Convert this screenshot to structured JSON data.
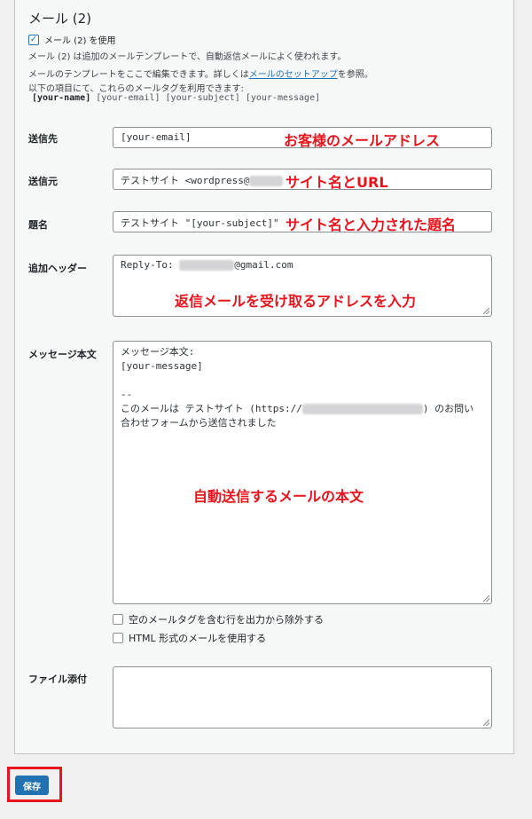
{
  "section": {
    "title": "メール (2)",
    "use_checkbox_label": "メール (2) を使用",
    "description": "メール (2) は追加のメールテンプレートで、自動返信メールによく使われます。",
    "edit_text_before": "メールのテンプレートをここで編集できます。詳しくは",
    "edit_link": "メールのセットアップ",
    "edit_text_after": "を参照。",
    "tags_intro": "以下の項目にて、これらのメールタグを利用できます:",
    "tags": {
      "name": "[your-name]",
      "others": " [your-email] [your-subject] [your-message]"
    }
  },
  "fields": {
    "to": {
      "label": "送信先",
      "value": "[your-email]",
      "annotation": "お客様のメールアドレス"
    },
    "from": {
      "label": "送信元",
      "value": "テストサイト <wordpress@",
      "annotation": "サイト名とURL"
    },
    "subject": {
      "label": "題名",
      "value": "テストサイト \"[your-subject]\"",
      "annotation": "サイト名と入力された題名"
    },
    "headers": {
      "label": "追加ヘッダー",
      "value_prefix": "Reply-To: ",
      "value_suffix": "@gmail.com",
      "annotation": "返信メールを受け取るアドレスを入力"
    },
    "body": {
      "label": "メッセージ本文",
      "line1": "メッセージ本文:",
      "line2": "[your-message]",
      "line3": "--",
      "line4_prefix": "このメールは テストサイト (https://",
      "line4_suffix": ") のお問い",
      "line5": "合わせフォームから送信されました",
      "annotation": "自動送信するメールの本文"
    },
    "attachments": {
      "label": "ファイル添付",
      "value": ""
    }
  },
  "options": {
    "exclude_blank": "空のメールタグを含む行を出力から除外する",
    "use_html": "HTML 形式のメールを使用する"
  },
  "save_button": "保存",
  "colors": {
    "accent": "#2271b1",
    "annotation": "#e7141d"
  }
}
